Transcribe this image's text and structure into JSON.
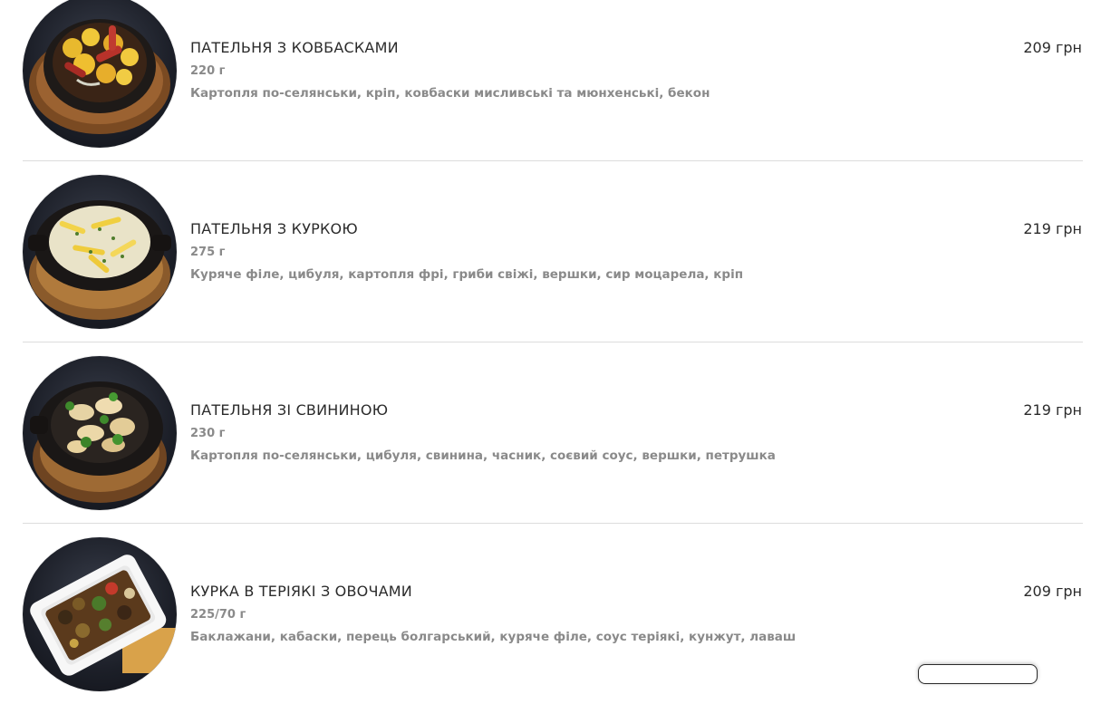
{
  "currency": "грн",
  "items": [
    {
      "name": "ПАТЕЛЬНЯ З КОВБАСКАМИ",
      "weight": "220 г",
      "description": "Картопля по-селянськи, кріп, ковбаски мисливські та мюнхенські, бекон",
      "price": "209 грн",
      "photo_icon": "skillet-sausages-photo"
    },
    {
      "name": "ПАТЕЛЬНЯ З КУРКОЮ",
      "weight": "275 г",
      "description": "Куряче філе, цибуля, картопля фрі, гриби свіжі, вершки, сир моцарела, кріп",
      "price": "219 грн",
      "photo_icon": "skillet-chicken-photo"
    },
    {
      "name": "ПАТЕЛЬНЯ ЗІ СВИНИНОЮ",
      "weight": "230 г",
      "description": "Картопля по-селянськи, цибуля, свинина, часник, соєвий соус, вершки, петрушка",
      "price": "219 грн",
      "photo_icon": "skillet-pork-photo"
    },
    {
      "name": "КУРКА В ТЕРІЯКІ З ОВОЧАМИ",
      "weight": "225/70 г",
      "description": "Баклажани, кабаски, перець болгарський, куряче філе, соус теріякі, кунжут, лаваш",
      "price": "209 грн",
      "photo_icon": "teriyaki-chicken-photo"
    }
  ],
  "colors": {
    "name": "#2b2b2b",
    "muted": "#8a8a8a",
    "divider": "#dcdcdc"
  }
}
